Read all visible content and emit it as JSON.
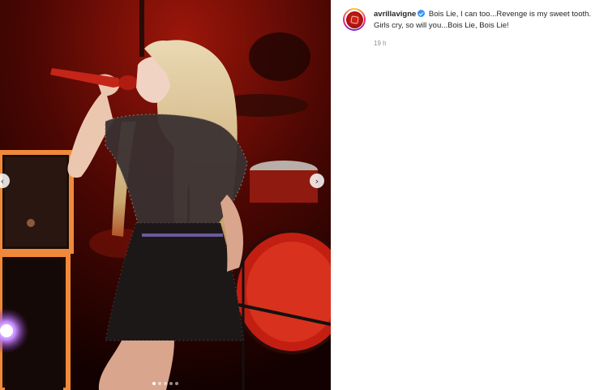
{
  "post": {
    "username": "avrillavigne",
    "caption_text": "Bois Lie, I can too...Revenge is my sweet tooth. Girls cry, so will you...Bois Lie, Bois Lie!",
    "timestamp": "19 h",
    "carousel": {
      "slide_count": 5,
      "active_slide": 1,
      "prev_icon": "chevron-left-icon",
      "next_icon": "chevron-right-icon",
      "prev_glyph": "‹",
      "next_glyph": "›"
    }
  },
  "colors": {
    "verified_badge": "#3897f0",
    "background_red": "#8a1208",
    "amp_orange": "#f0893a",
    "drum_red": "#c21f12"
  }
}
